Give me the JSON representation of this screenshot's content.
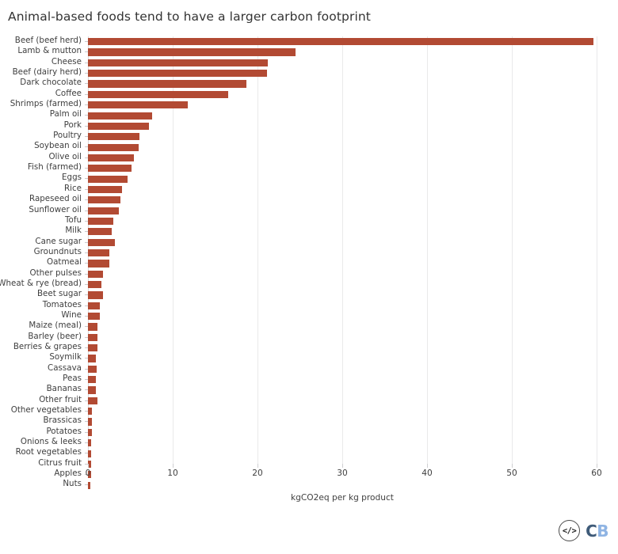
{
  "chart_data": {
    "type": "bar",
    "orientation": "horizontal",
    "title": "Animal-based foods tend to have a larger carbon footprint",
    "xlabel": "kgCO2eq per kg product",
    "ylabel": "",
    "xlim": [
      0,
      60
    ],
    "xticks": [
      0,
      10,
      20,
      30,
      40,
      50,
      60
    ],
    "xtick_labels": [
      "0",
      "10",
      "20",
      "30",
      "40",
      "50",
      "60"
    ],
    "grid": true,
    "grid_axis": "x",
    "legend": null,
    "bar_color": "#b24a33",
    "categories": [
      "Beef (beef herd)",
      "Lamb & mutton",
      "Cheese",
      "Beef (dairy herd)",
      "Dark chocolate",
      "Coffee",
      "Shrimps (farmed)",
      "Palm oil",
      "Pork",
      "Poultry",
      "Soybean oil",
      "Olive oil",
      "Fish (farmed)",
      "Eggs",
      "Rice",
      "Rapeseed oil",
      "Sunflower oil",
      "Tofu",
      "Milk",
      "Cane sugar",
      "Groundnuts",
      "Oatmeal",
      "Other pulses",
      "Wheat & rye (bread)",
      "Beet sugar",
      "Tomatoes",
      "Wine",
      "Maize (meal)",
      "Barley (beer)",
      "Berries & grapes",
      "Soymilk",
      "Cassava",
      "Peas",
      "Bananas",
      "Other fruit",
      "Other vegetables",
      "Brassicas",
      "Potatoes",
      "Onions & leeks",
      "Root vegetables",
      "Citrus fruit",
      "Apples",
      "Nuts"
    ],
    "values": [
      59.6,
      24.5,
      21.2,
      21.1,
      18.7,
      16.5,
      11.8,
      7.6,
      7.2,
      6.1,
      6.0,
      5.4,
      5.1,
      4.7,
      4.0,
      3.8,
      3.6,
      3.0,
      2.8,
      3.2,
      2.5,
      2.5,
      1.8,
      1.6,
      1.8,
      1.4,
      1.4,
      1.1,
      1.1,
      1.1,
      0.9,
      1.0,
      0.9,
      0.9,
      1.1,
      0.5,
      0.5,
      0.5,
      0.4,
      0.4,
      0.4,
      0.4,
      0.3
    ]
  },
  "logo": {
    "mark": "code-brackets-icon",
    "mark_glyph": "</>",
    "text_primary": "C",
    "text_secondary": "B"
  }
}
